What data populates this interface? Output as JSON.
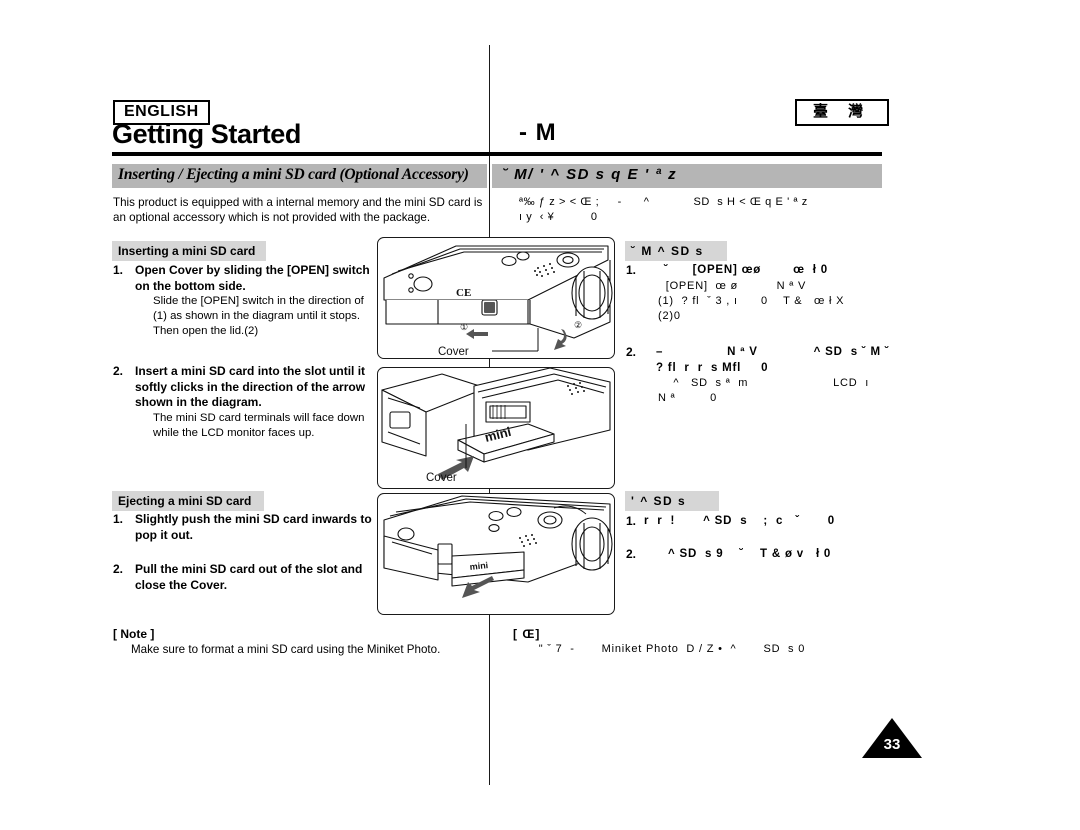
{
  "header": {
    "language_badge": "ENGLISH",
    "region_badge": "臺 灣",
    "chapter_title_en": "Getting Started",
    "chapter_title_cn": "- M"
  },
  "topic": {
    "en": "Inserting / Ejecting a mini SD card (Optional Accessory)",
    "cn": "˘ M/ '      ^ SD s q E ' ª z"
  },
  "intro": {
    "en": "This product is equipped with a internal memory and the mini SD card is an optional accessory which is not provided with the package.",
    "cn_line1": "ª‰ ƒ z > < Œ ;     -      ^            SD  s H < Œ q E ' ª z",
    "cn_line2": "ı y  ‹ ¥          0"
  },
  "sections": {
    "insert": {
      "heading_en": "Inserting a mini SD card",
      "heading_cn": "˘ M  ^ SD  s",
      "steps_en": [
        {
          "num": "1.",
          "bold": [
            "Open Cover by sliding the [OPEN] switch",
            "on the bottom side."
          ],
          "sub": [
            "Slide the [OPEN] switch in the direction of",
            "(1) as shown in the diagram until it stops.",
            "Then open the lid.(2)"
          ]
        },
        {
          "num": "2.",
          "bold": [
            "Insert a mini SD card into the slot until it",
            "softly clicks in the direction of the arrow",
            "shown in the diagram."
          ],
          "sub": [
            "The mini SD card terminals will face down",
            "while the LCD monitor faces up."
          ]
        }
      ],
      "steps_cn": [
        {
          "num": "1.",
          "bold": [
            "    ˘      [OPEN] œø        œ  ł 0"
          ],
          "sub": [
            "  [OPEN]  œ ø          N ª V",
            "(1)  ? fl  ˇ 3 , ı      0    T &   œ ł X",
            "(2)0"
          ]
        },
        {
          "num": "2.",
          "bold": [
            "  –                N ª V              ^ SD  s ˘ M ˘",
            "  ? fl  r  r  s Mfl     0"
          ],
          "sub": [
            "    ^   SD  s ª  m                      LCD  ı",
            "N ª         0"
          ]
        }
      ]
    },
    "eject": {
      "heading_en": "Ejecting a mini SD card",
      "heading_cn": "'        ^ SD  s",
      "steps_en": [
        {
          "num": "1.",
          "bold": [
            "Slightly push the mini SD card inwards to",
            "pop it out."
          ],
          "sub": []
        },
        {
          "num": "2.",
          "bold": [
            "Pull the mini SD card out of the slot and",
            "close the Cover."
          ],
          "sub": []
        }
      ],
      "steps_cn": [
        {
          "num": "1.",
          "bold": [
            "r  r  !       ^ SD  s    ;  c   ˇ       0"
          ],
          "sub": []
        },
        {
          "num": "2.",
          "bold": [
            "      ^ SD  s 9    ˘    T & ø v   ł 0"
          ],
          "sub": []
        }
      ]
    }
  },
  "note": {
    "title_en": "[ Note ]",
    "text_en": "Make sure to format a mini SD card using the Miniket Photo.",
    "title_cn": "[    Œ]",
    "text_cn": "  \" ˇ 7  -       Miniket Photo  D / Z •  ^       SD  s 0"
  },
  "figures": {
    "fig1_label": "Cover",
    "fig1_callout_1": "①",
    "fig1_callout_2": "②",
    "fig1_ce_mark": "CE",
    "fig2_label": "Cover",
    "fig2_card_text": "mini",
    "fig3_card_text": "mini"
  },
  "page_number": "33",
  "colors": {
    "topic_bar": "#b5b5b5",
    "subhead_bar": "#d6d6d6",
    "rule": "#000000"
  }
}
